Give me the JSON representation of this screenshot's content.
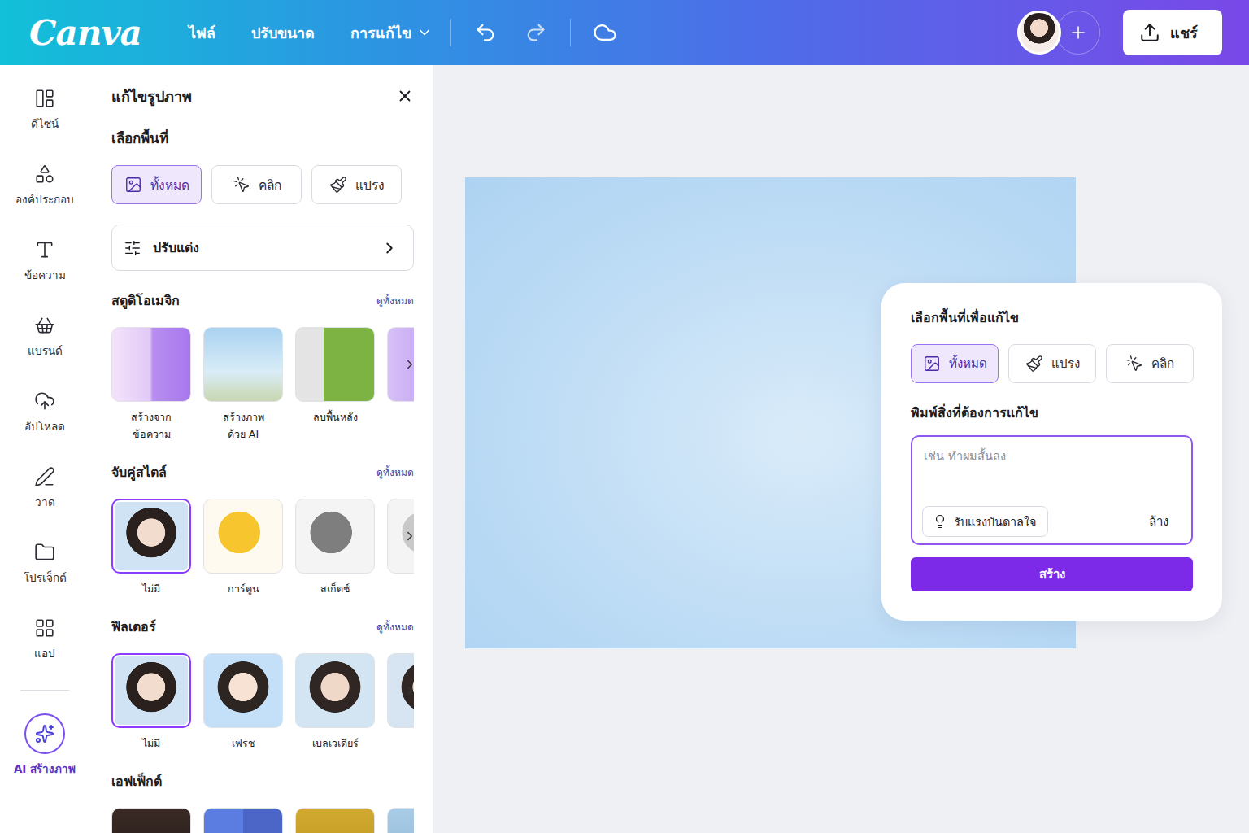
{
  "topbar": {
    "logo": "Canva",
    "menu": [
      {
        "label": "ไฟล์",
        "dropdown": false
      },
      {
        "label": "ปรับขนาด",
        "dropdown": false
      },
      {
        "label": "การแก้ไข",
        "dropdown": true
      }
    ],
    "share": "แชร์"
  },
  "rail": [
    {
      "label": "ดีไซน์",
      "kind": "tab",
      "selected": false
    },
    {
      "label": "องค์ประกอบ",
      "kind": "tab",
      "selected": false
    },
    {
      "label": "ข้อความ",
      "kind": "tab",
      "selected": false
    },
    {
      "label": "แบรนด์",
      "kind": "tab",
      "selected": false
    },
    {
      "label": "อัปโหลด",
      "kind": "tab",
      "selected": false
    },
    {
      "label": "วาด",
      "kind": "tab",
      "selected": false
    },
    {
      "label": "โปรเจ็กต์",
      "kind": "tab",
      "selected": false
    },
    {
      "label": "แอป",
      "kind": "tab",
      "selected": false
    },
    {
      "label": "AI สร้างภาพ",
      "kind": "feature",
      "selected": true
    }
  ],
  "panel": {
    "title": "แก้ไขรูปภาพ",
    "area_heading": "เลือกพื้นที่",
    "area_options": [
      {
        "label": "ทั้งหมด",
        "kind": "all",
        "selected": true
      },
      {
        "label": "คลิก",
        "kind": "click",
        "selected": false
      },
      {
        "label": "แปรง",
        "kind": "brush",
        "selected": false
      }
    ],
    "adjust": "ปรับแต่ง",
    "sections": [
      {
        "title": "สตูดิโอเมจิก",
        "see_all": "ดูทั้งหมด",
        "more": true,
        "items": [
          {
            "label": "สร้างจาก\nข้อความ",
            "selected": false
          },
          {
            "label": "สร้างภาพ\nด้วย AI",
            "selected": false
          },
          {
            "label": "ลบพื้นหลัง",
            "selected": false
          }
        ]
      },
      {
        "title": "จับคู่สไตล์",
        "see_all": "ดูทั้งหมด",
        "more": true,
        "items": [
          {
            "label": "ไม่มี",
            "selected": true
          },
          {
            "label": "การ์ตูน",
            "selected": false
          },
          {
            "label": "สเก็ตช์",
            "selected": false
          }
        ]
      },
      {
        "title": "ฟิลเตอร์",
        "see_all": "ดูทั้งหมด",
        "more": true,
        "items": [
          {
            "label": "ไม่มี",
            "selected": true
          },
          {
            "label": "เฟรช",
            "selected": false
          },
          {
            "label": "เบลเวเดียร์",
            "selected": false
          }
        ]
      },
      {
        "title": "เอฟเฟ็กต์",
        "more": true,
        "items": [
          {
            "selected": false
          },
          {
            "selected": false
          },
          {
            "selected": false
          }
        ]
      }
    ]
  },
  "editor": {
    "heading": "เลือกพื้นที่เพื่อแก้ไข",
    "area_options": [
      {
        "label": "ทั้งหมด",
        "kind": "all",
        "selected": true
      },
      {
        "label": "แปรง",
        "kind": "brush",
        "selected": false
      },
      {
        "label": "คลิก",
        "kind": "click",
        "selected": false
      }
    ],
    "prompt_label": "พิมพ์สิ่งที่ต้องการแก้ไข",
    "placeholder": "เช่น ทำผมสั้นลง",
    "inspire": "รับแรงบันดาลใจ",
    "clear": "ล้าง",
    "submit": "สร้าง"
  }
}
